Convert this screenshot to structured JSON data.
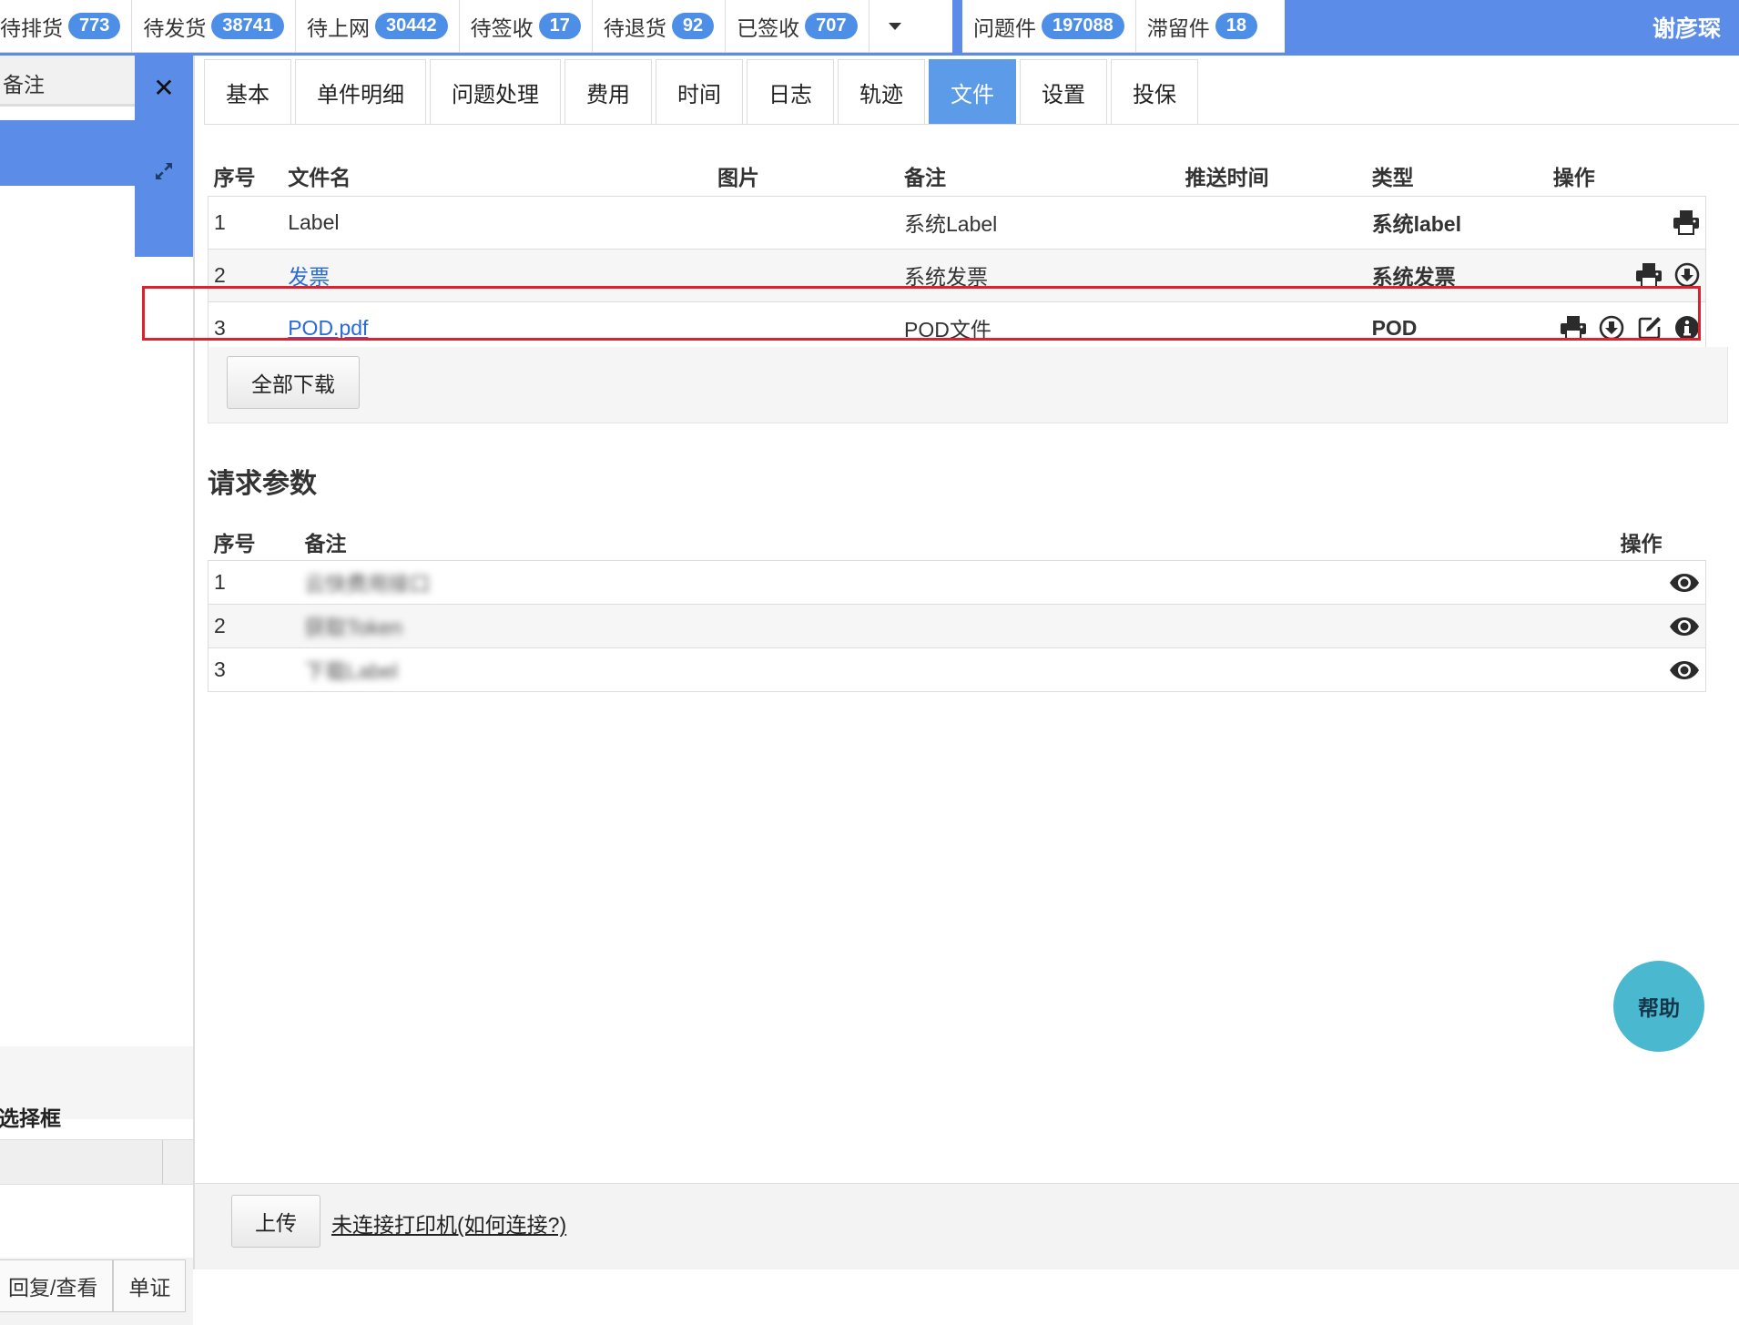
{
  "topbar": {
    "group1": [
      {
        "label": "待排货",
        "count": "773"
      },
      {
        "label": "待发货",
        "count": "38741"
      },
      {
        "label": "待上网",
        "count": "30442"
      },
      {
        "label": "待签收",
        "count": "17"
      },
      {
        "label": "待退货",
        "count": "92"
      },
      {
        "label": "已签收",
        "count": "707"
      }
    ],
    "group2": [
      {
        "label": "问题件",
        "count": "197088"
      },
      {
        "label": "滞留件",
        "count": "18"
      }
    ],
    "user": "谢彦琛"
  },
  "left": {
    "field_label": "备注",
    "close_symbol": "✕",
    "select_label": "选择框",
    "bottom_buttons": [
      "回复/查看",
      "单证"
    ]
  },
  "tabs": [
    "基本",
    "单件明细",
    "问题处理",
    "费用",
    "时间",
    "日志",
    "轨迹",
    "文件",
    "设置",
    "投保"
  ],
  "active_tab": "文件",
  "files": {
    "headers": {
      "index": "序号",
      "name": "文件名",
      "image": "图片",
      "remark": "备注",
      "push_time": "推送时间",
      "type": "类型",
      "ops": "操作"
    },
    "rows": [
      {
        "index": "1",
        "name": "Label",
        "remark": "系统Label",
        "type": "系统label"
      },
      {
        "index": "2",
        "name": "发票",
        "remark": "系统发票",
        "type": "系统发票"
      },
      {
        "index": "3",
        "name": "POD.pdf",
        "remark": "POD文件",
        "type": "POD"
      }
    ],
    "download_all": "全部下载"
  },
  "params": {
    "title": "请求参数",
    "headers": {
      "index": "序号",
      "remark": "备注",
      "ops": "操作"
    },
    "rows": [
      {
        "index": "1",
        "remark": "云快费用接口"
      },
      {
        "index": "2",
        "remark": "获取Token"
      },
      {
        "index": "3",
        "remark": "下载Label"
      }
    ]
  },
  "help": "帮助",
  "footer": {
    "upload": "上传",
    "printer_status": "未连接打印机(如何连接?)"
  },
  "colors": {
    "primary_blue": "#5b8ce8",
    "badge_blue": "#4d8fe6",
    "link_blue": "#2a6ad6",
    "highlight_red": "#e0202a",
    "help_teal": "#4ab8cf"
  }
}
